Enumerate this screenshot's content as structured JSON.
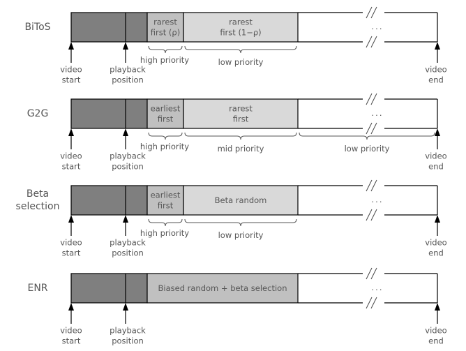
{
  "colors": {
    "played": "#7f7f7f",
    "high": "#c0c0c0",
    "low": "#d9d9d9",
    "enr": "#c0c0c0",
    "line": "#000000",
    "text": "#555555"
  },
  "common": {
    "video_start": [
      "video",
      "start"
    ],
    "playback_position": [
      "playback",
      "position"
    ],
    "video_end": [
      "video",
      "end"
    ],
    "ellipsis": "..."
  },
  "rows": [
    {
      "name": "bitos",
      "label": [
        "BiToS"
      ],
      "segments": [
        {
          "lines": [
            "rarest",
            "first (ρ)"
          ],
          "fill": "high"
        },
        {
          "lines": [
            "rarest",
            "first (1−ρ)"
          ],
          "fill": "low"
        }
      ],
      "braces": [
        {
          "label": "high priority",
          "span": "seg1"
        },
        {
          "label": "low priority",
          "span": "seg2"
        }
      ]
    },
    {
      "name": "g2g",
      "label": [
        "G2G"
      ],
      "segments": [
        {
          "lines": [
            "earliest",
            "first"
          ],
          "fill": "high"
        },
        {
          "lines": [
            "rarest",
            "first"
          ],
          "fill": "low"
        }
      ],
      "braces": [
        {
          "label": "high priority",
          "span": "seg1"
        },
        {
          "label": "mid priority",
          "span": "seg2"
        },
        {
          "label": "low priority",
          "span": "rest"
        }
      ]
    },
    {
      "name": "beta-selection",
      "label": [
        "Beta",
        "selection"
      ],
      "segments": [
        {
          "lines": [
            "earliest",
            "first"
          ],
          "fill": "high"
        },
        {
          "lines": [
            "Beta random"
          ],
          "fill": "low"
        }
      ],
      "braces": [
        {
          "label": "high priority",
          "span": "seg1"
        },
        {
          "label": "low priority",
          "span": "seg2"
        }
      ]
    },
    {
      "name": "enr",
      "label": [
        "ENR"
      ],
      "segments": [
        {
          "lines": [
            "Biased random + beta selection"
          ],
          "fill": "enr",
          "merged": true
        }
      ],
      "braces": []
    }
  ]
}
